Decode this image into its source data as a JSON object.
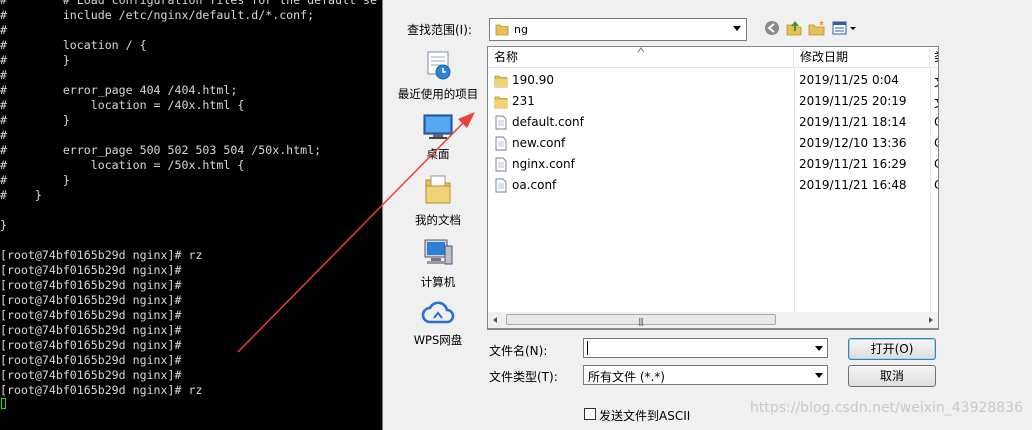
{
  "terminal": {
    "lines": [
      "#        # Load configuration files for the default se",
      "#        include /etc/nginx/default.d/*.conf;",
      "#",
      "#        location / {",
      "#        }",
      "#",
      "#        error_page 404 /404.html;",
      "#            location = /40x.html {",
      "#        }",
      "#",
      "#        error_page 500 502 503 504 /50x.html;",
      "#            location = /50x.html {",
      "#        }",
      "#    }",
      "",
      "}",
      "",
      "[root@74bf0165b29d nginx]# rz",
      "[root@74bf0165b29d nginx]#",
      "[root@74bf0165b29d nginx]#",
      "[root@74bf0165b29d nginx]#",
      "[root@74bf0165b29d nginx]#",
      "[root@74bf0165b29d nginx]#",
      "[root@74bf0165b29d nginx]#",
      "[root@74bf0165b29d nginx]#",
      "[root@74bf0165b29d nginx]#",
      "[root@74bf0165b29d nginx]# rz"
    ],
    "cursor_color": "#19e219",
    "text_color": "#d8d8d8"
  },
  "dialog": {
    "lookin_label": "查找范围(I):",
    "lookin_value": "ng",
    "places": [
      {
        "label": "最近使用的项目",
        "icon": "recent-items-icon"
      },
      {
        "label": "桌面",
        "icon": "desktop-icon"
      },
      {
        "label": "我的文档",
        "icon": "documents-icon"
      },
      {
        "label": "计算机",
        "icon": "computer-icon"
      },
      {
        "label": "WPS网盘",
        "icon": "cloud-icon"
      }
    ],
    "columns": {
      "name": "名称",
      "date": "修改日期",
      "extra": "类"
    },
    "files": [
      {
        "name": "190.90",
        "date": "2019/11/25 0:04",
        "type": "folder",
        "extra": "文"
      },
      {
        "name": "231",
        "date": "2019/11/25 20:19",
        "type": "folder",
        "extra": "文"
      },
      {
        "name": "default.conf",
        "date": "2019/11/21 18:14",
        "type": "file",
        "extra": "C"
      },
      {
        "name": "new.conf",
        "date": "2019/12/10 13:36",
        "type": "file",
        "extra": "C"
      },
      {
        "name": "nginx.conf",
        "date": "2019/11/21 16:29",
        "type": "file",
        "extra": "C"
      },
      {
        "name": "oa.conf",
        "date": "2019/11/21 16:48",
        "type": "file",
        "extra": "C"
      }
    ],
    "filename_label": "文件名(N):",
    "filename_value": "",
    "filetype_label": "文件类型(T):",
    "filetype_value": "所有文件 (*.*)",
    "open_button": "打开(O)",
    "cancel_button": "取消",
    "ascii_checkbox_label": "发送文件到ASCII",
    "ascii_checked": false
  },
  "annotation": {
    "arrow_color": "#e8403a"
  },
  "watermark": "https://blog.csdn.net/weixin_43928836"
}
